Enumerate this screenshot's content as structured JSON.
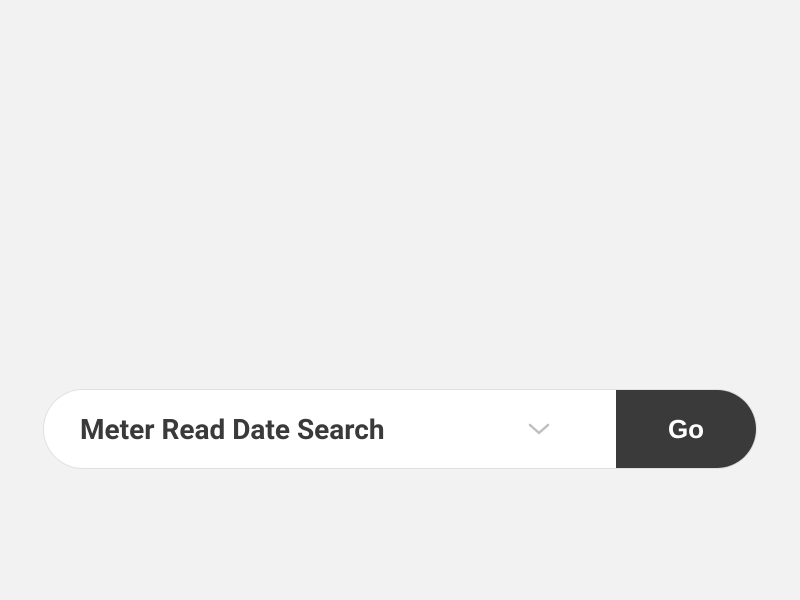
{
  "search": {
    "selected_label": "Meter Read Date Search",
    "go_label": "Go"
  }
}
